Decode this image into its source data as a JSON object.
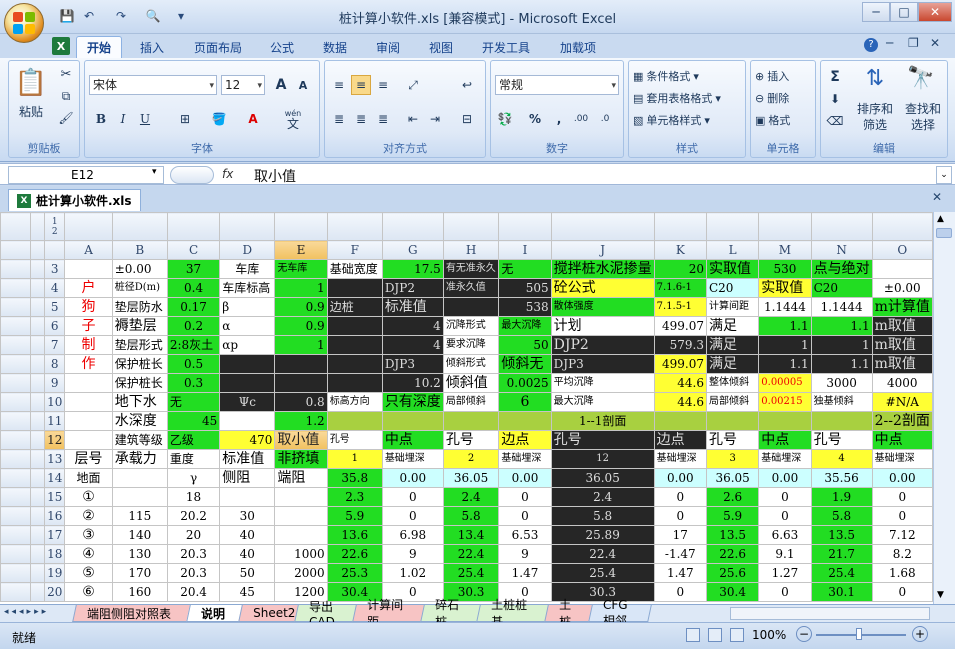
{
  "window": {
    "title": "桩计算小软件.xls  [兼容模式] - Microsoft Excel"
  },
  "ribbon_tabs": [
    "开始",
    "插入",
    "页面布局",
    "公式",
    "数据",
    "审阅",
    "视图",
    "开发工具",
    "加载项"
  ],
  "clipboard": {
    "paste": "粘贴",
    "group": "剪贴板"
  },
  "font": {
    "name": "宋体",
    "size": "12",
    "group": "字体",
    "bold": "B",
    "italic": "I",
    "underline": "U",
    "grow": "A",
    "shrink": "A",
    "wen": "wén",
    "wen_char": "文"
  },
  "alignment": {
    "group": "对齐方式"
  },
  "number": {
    "format": "常规",
    "group": "数字",
    "percent": "%",
    "comma": ",",
    "dec_inc": ".00",
    "dec_dec": ".0"
  },
  "styles": {
    "conditional": "条件格式",
    "table": "套用表格格式",
    "cell": "单元格样式",
    "group": "样式"
  },
  "cells": {
    "insert": "插入",
    "delete": "删除",
    "format": "格式",
    "group": "单元格"
  },
  "editing": {
    "sort": "排序和",
    "sort2": "筛选",
    "find": "查找和",
    "find2": "选择",
    "group": "编辑",
    "sigma": "Σ"
  },
  "formula_bar": {
    "name_box": "E12",
    "fx": "fx",
    "value": "取小值"
  },
  "workbook": {
    "tab": "桩计算小软件.xls"
  },
  "outline_levels": [
    "1",
    "2"
  ],
  "columns": [
    "A",
    "B",
    "C",
    "D",
    "E",
    "F",
    "G",
    "H",
    "I",
    "J",
    "K",
    "L",
    "M",
    "N",
    "O"
  ],
  "rows": [
    {
      "n": "3",
      "cells": [
        "",
        "±0.00",
        "37",
        "车库",
        "无车库",
        "基础宽度",
        "17.5",
        "有无准永久",
        "无",
        "搅拌桩水泥掺量",
        "20",
        "实取值",
        "530",
        "点与绝对",
        ""
      ]
    },
    {
      "n": "4",
      "cells": [
        "户",
        "桩径D(m)",
        "0.4",
        "车库标高",
        "1",
        "",
        "DJP2",
        "准永久值",
        "505",
        "砼公式",
        "7.1.6-1",
        "C20",
        "实取值",
        "C20",
        "±0.00"
      ]
    },
    {
      "n": "5",
      "cells": [
        "狗",
        "垫层防水",
        "0.17",
        "β",
        "0.9",
        "边桩",
        "标准值",
        "",
        "538",
        "散体强度",
        "7.1.5-1",
        "计算间距",
        "1.1444",
        "1.1444",
        "m计算值"
      ]
    },
    {
      "n": "6",
      "cells": [
        "子",
        "褥垫层",
        "0.2",
        "α",
        "0.9",
        "",
        "4",
        "沉降形式",
        "最大沉降",
        "计划",
        "499.07",
        "满足",
        "1.1",
        "1.1",
        "m取值"
      ]
    },
    {
      "n": "7",
      "cells": [
        "制",
        "垫层形式",
        "2:8灰土",
        "αp",
        "1",
        "",
        "4",
        "要求沉降",
        "50",
        "DJP2",
        "579.3",
        "满足",
        "1",
        "1",
        "m取值"
      ]
    },
    {
      "n": "8",
      "cells": [
        "作",
        "保护桩长",
        "0.5",
        "",
        "",
        "",
        "DJP3",
        "倾斜形式",
        "倾斜无",
        "DJP3",
        "499.07",
        "满足",
        "1.1",
        "1.1",
        "m取值"
      ]
    },
    {
      "n": "9",
      "cells": [
        "",
        "保护桩长",
        "0.3",
        "",
        "",
        "",
        "10.2",
        "倾斜值",
        "0.0025",
        "平均沉降",
        "44.6",
        "整体倾斜",
        "0.00005",
        "3000",
        "4000"
      ]
    },
    {
      "n": "10",
      "cells": [
        "",
        "地下水",
        "无",
        "Ψc",
        "0.8",
        "标高方向",
        "只有深度",
        "局部倾斜",
        "6",
        "最大沉降",
        "44.6",
        "局部倾斜",
        "0.00215",
        "独基倾斜",
        "#N/A"
      ]
    },
    {
      "n": "11",
      "cells": [
        "",
        "水深度",
        "45",
        "",
        "1.2",
        "",
        "",
        "",
        "",
        "1--1剖面",
        "",
        "",
        "",
        "",
        "2--2剖面"
      ]
    },
    {
      "n": "12",
      "cells": [
        "",
        "建筑等级",
        "乙级",
        "470",
        "取小值",
        "孔号",
        "中点",
        "孔号",
        "边点",
        "孔号",
        "边点",
        "孔号",
        "中点",
        "孔号",
        "中点"
      ]
    },
    {
      "n": "13",
      "cells": [
        "层号",
        "承载力",
        "重度",
        "标准值",
        "非挤填",
        "1",
        "基础埋深",
        "2",
        "基础埋深",
        "12",
        "基础埋深",
        "3",
        "基础埋深",
        "4",
        "基础埋深"
      ]
    },
    {
      "n": "14",
      "cells": [
        "地面",
        "",
        "γ",
        "侧阻",
        "端阻",
        "35.8",
        "0.00",
        "36.05",
        "0.00",
        "36.05",
        "0.00",
        "36.05",
        "0.00",
        "35.56",
        "0.00"
      ]
    },
    {
      "n": "15",
      "cells": [
        "①",
        "",
        "18",
        "",
        "",
        "2.3",
        "0",
        "2.4",
        "0",
        "2.4",
        "0",
        "2.6",
        "0",
        "1.9",
        "0"
      ]
    },
    {
      "n": "16",
      "cells": [
        "②",
        "115",
        "20.2",
        "30",
        "",
        "5.9",
        "0",
        "5.8",
        "0",
        "5.8",
        "0",
        "5.9",
        "0",
        "5.8",
        "0"
      ]
    },
    {
      "n": "17",
      "cells": [
        "③",
        "140",
        "20",
        "40",
        "",
        "13.6",
        "6.98",
        "13.4",
        "6.53",
        "25.89",
        "17",
        "13.5",
        "6.63",
        "13.5",
        "7.12"
      ]
    },
    {
      "n": "18",
      "cells": [
        "④",
        "130",
        "20.3",
        "40",
        "1000",
        "22.6",
        "9",
        "22.4",
        "9",
        "22.4",
        "-1.47",
        "22.6",
        "9.1",
        "21.7",
        "8.2"
      ]
    },
    {
      "n": "19",
      "cells": [
        "⑤",
        "170",
        "20.3",
        "50",
        "2000",
        "25.3",
        "1.02",
        "25.4",
        "1.47",
        "25.4",
        "1.47",
        "25.6",
        "1.27",
        "25.4",
        "1.68"
      ]
    },
    {
      "n": "20",
      "cells": [
        "⑥",
        "160",
        "20.4",
        "45",
        "1200",
        "30.4",
        "0",
        "30.3",
        "0",
        "30.3",
        "0",
        "30.4",
        "0",
        "30.1",
        "0"
      ]
    }
  ],
  "sheet_tabs": [
    "端阻侧阻对照表",
    "说明",
    "Sheet2",
    "导出CAD",
    "计算间距",
    "碎石桩",
    "土桩桩基",
    "土桩",
    "CFG相邻"
  ],
  "status": {
    "mode": "就绪",
    "zoom": "100%"
  },
  "colors": {
    "green": "#22dd22",
    "yellow": "#ffff33",
    "black": "#262626",
    "selection": "#f1c15f"
  }
}
